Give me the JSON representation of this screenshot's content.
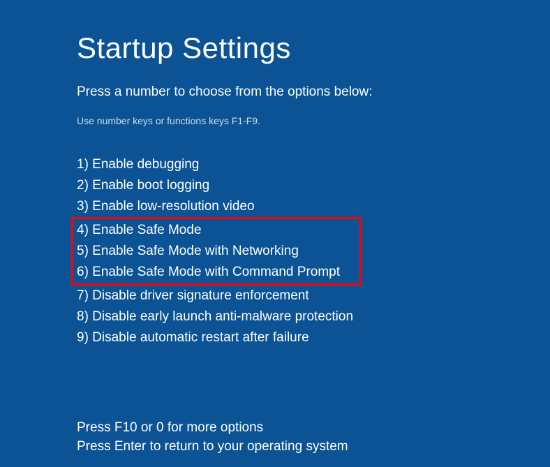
{
  "title": "Startup Settings",
  "subtitle": "Press a number to choose from the options below:",
  "hint": "Use number keys or functions keys F1-F9.",
  "options": [
    "1) Enable debugging",
    "2) Enable boot logging",
    "3) Enable low-resolution video",
    "4) Enable Safe Mode",
    "5) Enable Safe Mode with Networking",
    "6) Enable Safe Mode with Command Prompt",
    "7) Disable driver signature enforcement",
    "8) Disable early launch anti-malware protection",
    "9) Disable automatic restart after failure"
  ],
  "footer": {
    "more_options": "Press F10 or 0 for more options",
    "return": "Press Enter to return to your operating system"
  }
}
